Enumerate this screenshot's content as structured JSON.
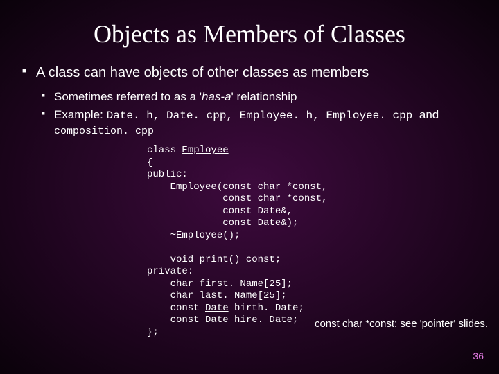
{
  "title": "Objects as Members of Classes",
  "bullets": {
    "l1": "A class can have objects of other classes as members",
    "l2a_pre": "Sometimes referred to as a '",
    "l2a_em": "has-a",
    "l2a_post": "' relationship",
    "l2b_label": "Example: ",
    "l2b_code": "Date. h, Date. cpp, Employee. h, Employee. cpp ",
    "l2b_tail": "and",
    "l2b_sub": "composition. cpp"
  },
  "code": {
    "l1_pre": "class ",
    "l1_u": "Employee",
    "l2": "{",
    "l3": "public:",
    "l4": "    Employee(const char *const,",
    "l5": "             const char *const,",
    "l6": "             const Date&,",
    "l7": "             const Date&);",
    "l8": "    ~Employee();",
    "blank": "",
    "l9": "    void print() const;",
    "l10": "private:",
    "l11": "    char first. Name[25];",
    "l12": "    char last. Name[25];",
    "l13_pre": "    const ",
    "l13_u": "Date",
    "l13_post": " birth. Date;",
    "l14_pre": "    const ",
    "l14_u": "Date",
    "l14_post": " hire. Date;",
    "l15": "};"
  },
  "annotation": "const char *const: see 'pointer' slides.",
  "page_number": "36"
}
